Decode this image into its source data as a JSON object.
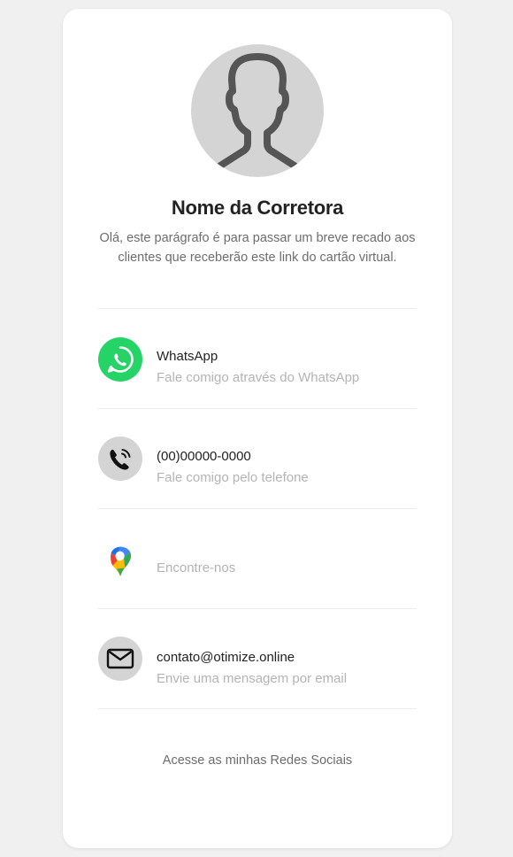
{
  "profile": {
    "name": "Nome da Corretora",
    "description": "Olá, este parágrafo é para passar um breve recado aos clientes que receberão este link do cartão virtual."
  },
  "contacts": [
    {
      "title": "WhatsApp",
      "subtitle": "Fale comigo através do WhatsApp",
      "icon": "whatsapp-icon",
      "icon_bg": "#25d366"
    },
    {
      "title": "(00)00000-0000",
      "subtitle": "Fale comigo pelo telefone",
      "icon": "phone-icon",
      "icon_bg": "#d4d4d4"
    },
    {
      "subtitle": "Encontre-nos",
      "icon": "google-maps-pin-icon"
    },
    {
      "title": "contato@otimize.online",
      "subtitle": "Envie uma mensagem por email",
      "icon": "email-icon",
      "icon_bg": "#d4d4d4"
    }
  ],
  "social": {
    "label": "Acesse as minhas Redes Sociais"
  },
  "colors": {
    "page_bg": "#f0f0f0",
    "card_bg": "#ffffff",
    "avatar_bg": "#d4d4d4",
    "whatsapp": "#25d366"
  }
}
